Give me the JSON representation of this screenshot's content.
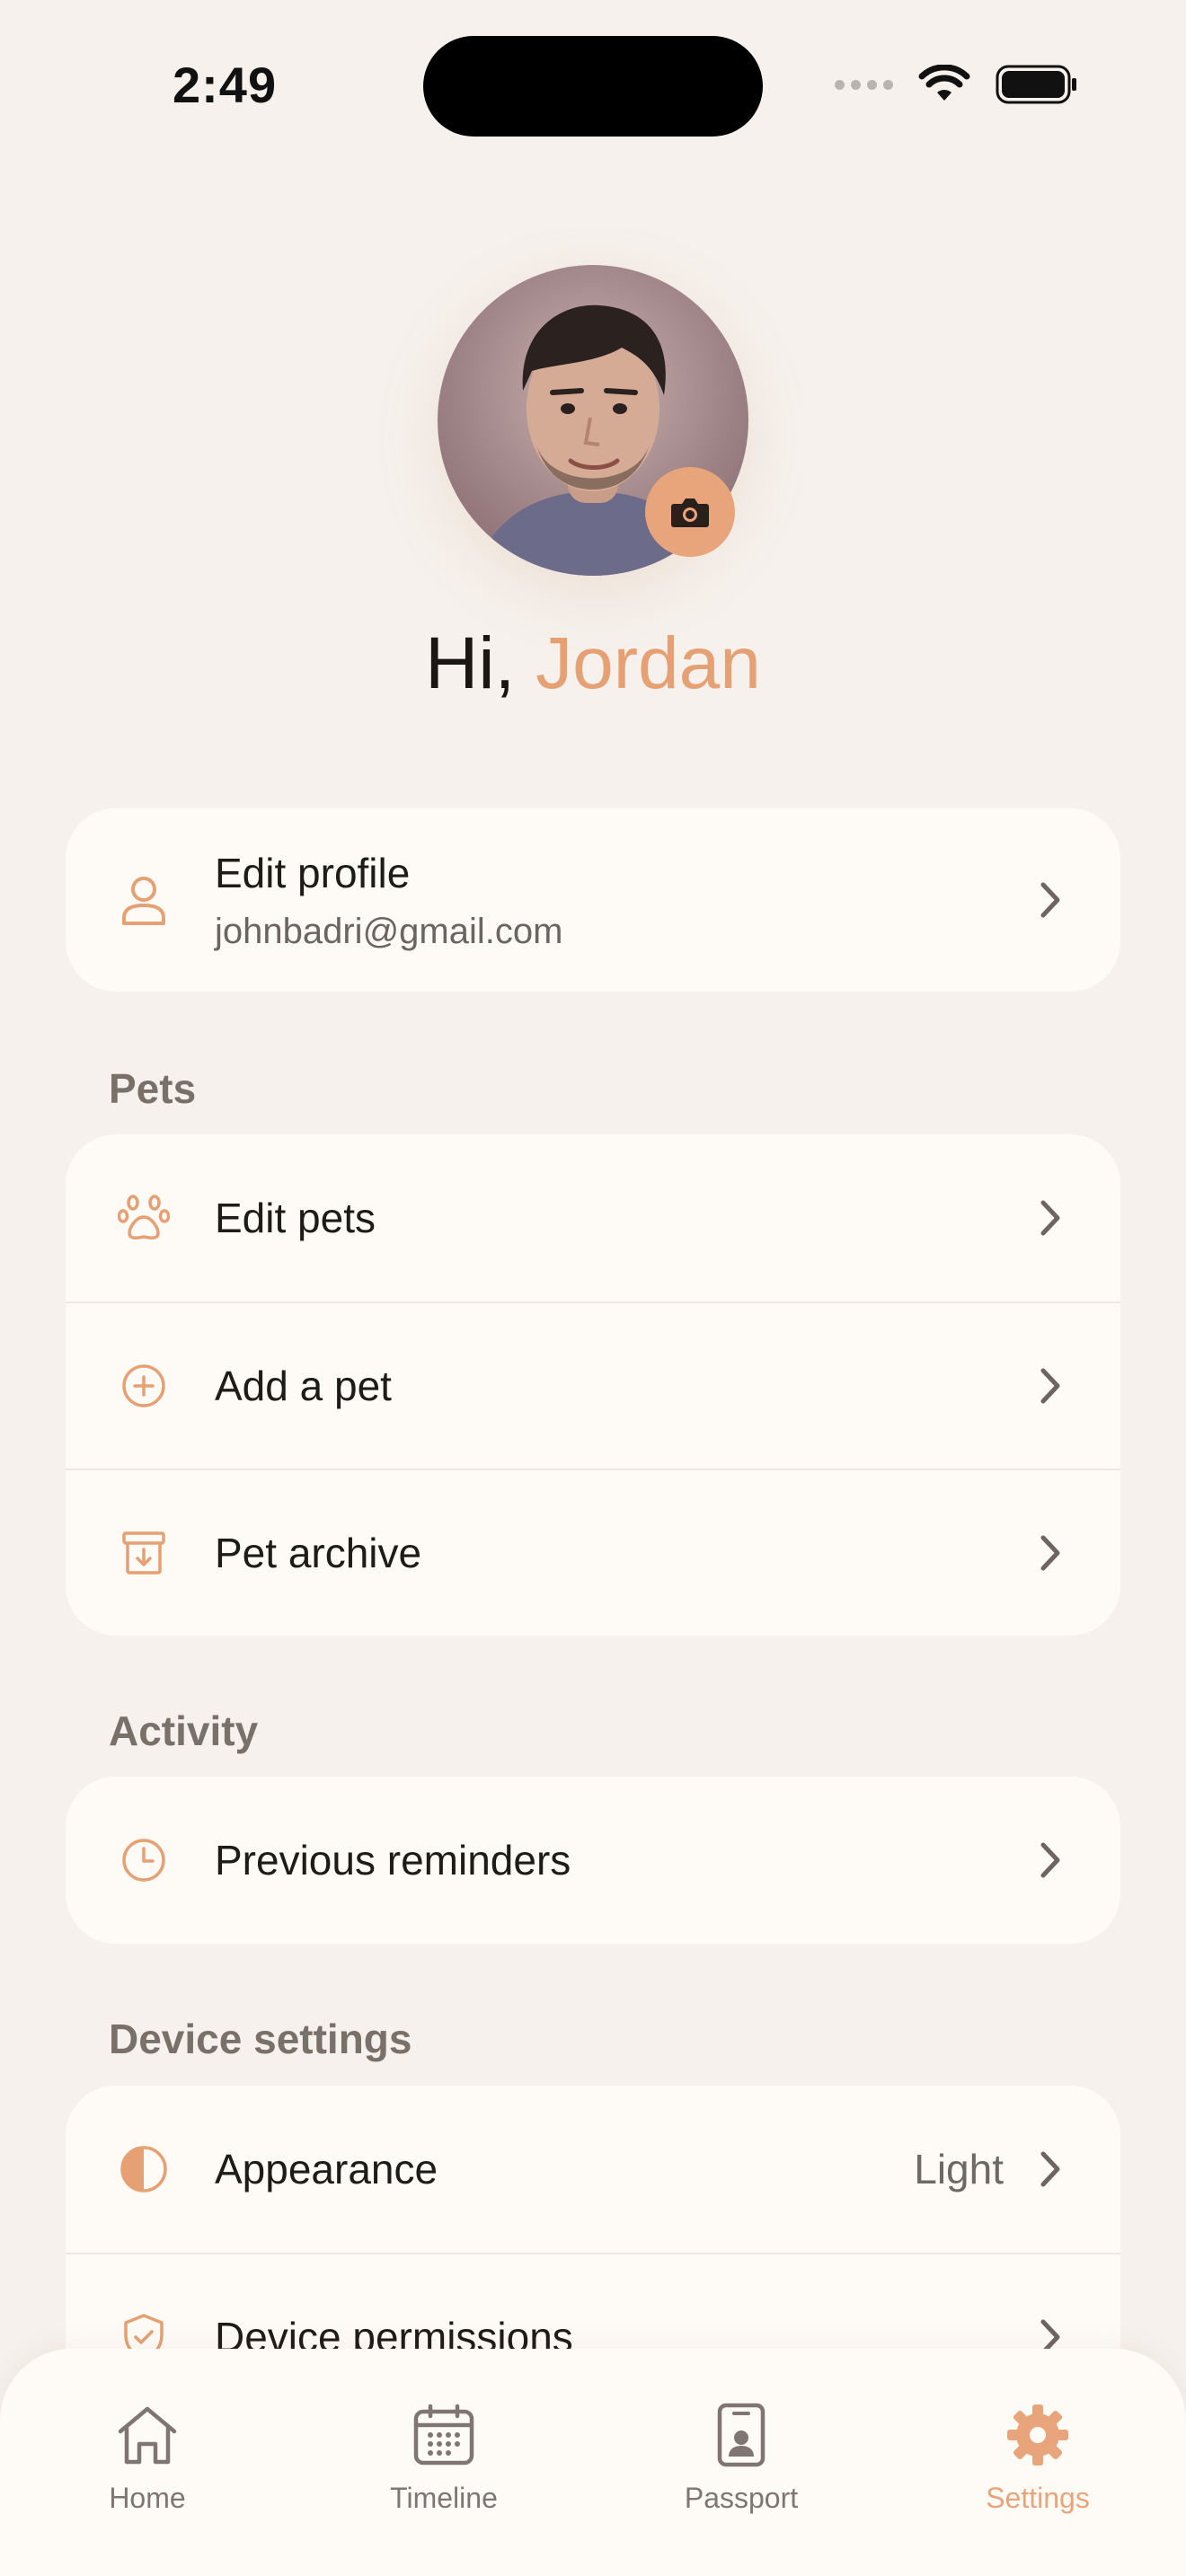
{
  "status_bar": {
    "time": "2:49"
  },
  "profile": {
    "greeting": "Hi,",
    "name": "Jordan"
  },
  "account_card": {
    "title": "Edit profile",
    "email": "johnbadri@gmail.com"
  },
  "sections": {
    "pets": {
      "title": "Pets",
      "items": [
        {
          "label": "Edit pets",
          "icon": "paw-icon"
        },
        {
          "label": "Add a pet",
          "icon": "plus-circle-icon"
        },
        {
          "label": "Pet archive",
          "icon": "archive-box-icon"
        }
      ]
    },
    "activity": {
      "title": "Activity",
      "items": [
        {
          "label": "Previous reminders",
          "icon": "clock-icon"
        }
      ]
    },
    "device": {
      "title": "Device settings",
      "items": [
        {
          "label": "Appearance",
          "value": "Light",
          "icon": "contrast-icon"
        },
        {
          "label": "Device permissions",
          "icon": "shield-check-icon"
        }
      ]
    }
  },
  "tabbar": {
    "tabs": [
      {
        "label": "Home",
        "icon": "home-icon"
      },
      {
        "label": "Timeline",
        "icon": "calendar-icon"
      },
      {
        "label": "Passport",
        "icon": "passport-icon"
      },
      {
        "label": "Settings",
        "icon": "gear-icon",
        "active": true
      }
    ]
  },
  "colors": {
    "accent": "#e8a47a",
    "background": "#f6f1ec",
    "card": "#fefbf7"
  }
}
